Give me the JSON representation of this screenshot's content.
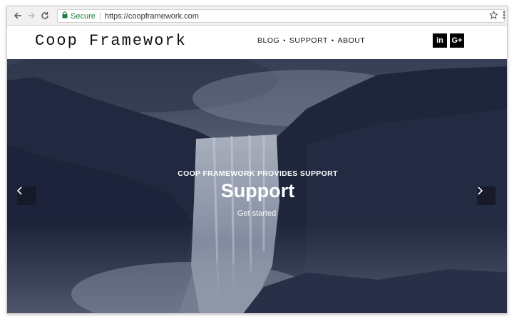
{
  "browser": {
    "secure_label": "Secure",
    "url": "https://coopframework.com",
    "icons": [
      "back-icon",
      "forward-icon",
      "reload-icon",
      "lock-icon",
      "star-icon",
      "menu-icon"
    ]
  },
  "site": {
    "logo": "Coop Framework",
    "nav": [
      {
        "label": "BLOG"
      },
      {
        "label": "SUPPORT"
      },
      {
        "label": "ABOUT"
      }
    ],
    "separator": "•",
    "social": [
      {
        "label": "in",
        "icon": "linkedin-icon"
      },
      {
        "label": "G+",
        "icon": "google-plus-icon"
      }
    ]
  },
  "hero": {
    "eyebrow": "COOP FRAMEWORK PROVIDES SUPPORT",
    "title": "Support",
    "cta": "Get started",
    "prev_glyph": "‹",
    "next_glyph": "›"
  },
  "colors": {
    "secure_green": "#188038",
    "hero_tint": "#2a3350",
    "social_bg": "#000000"
  }
}
